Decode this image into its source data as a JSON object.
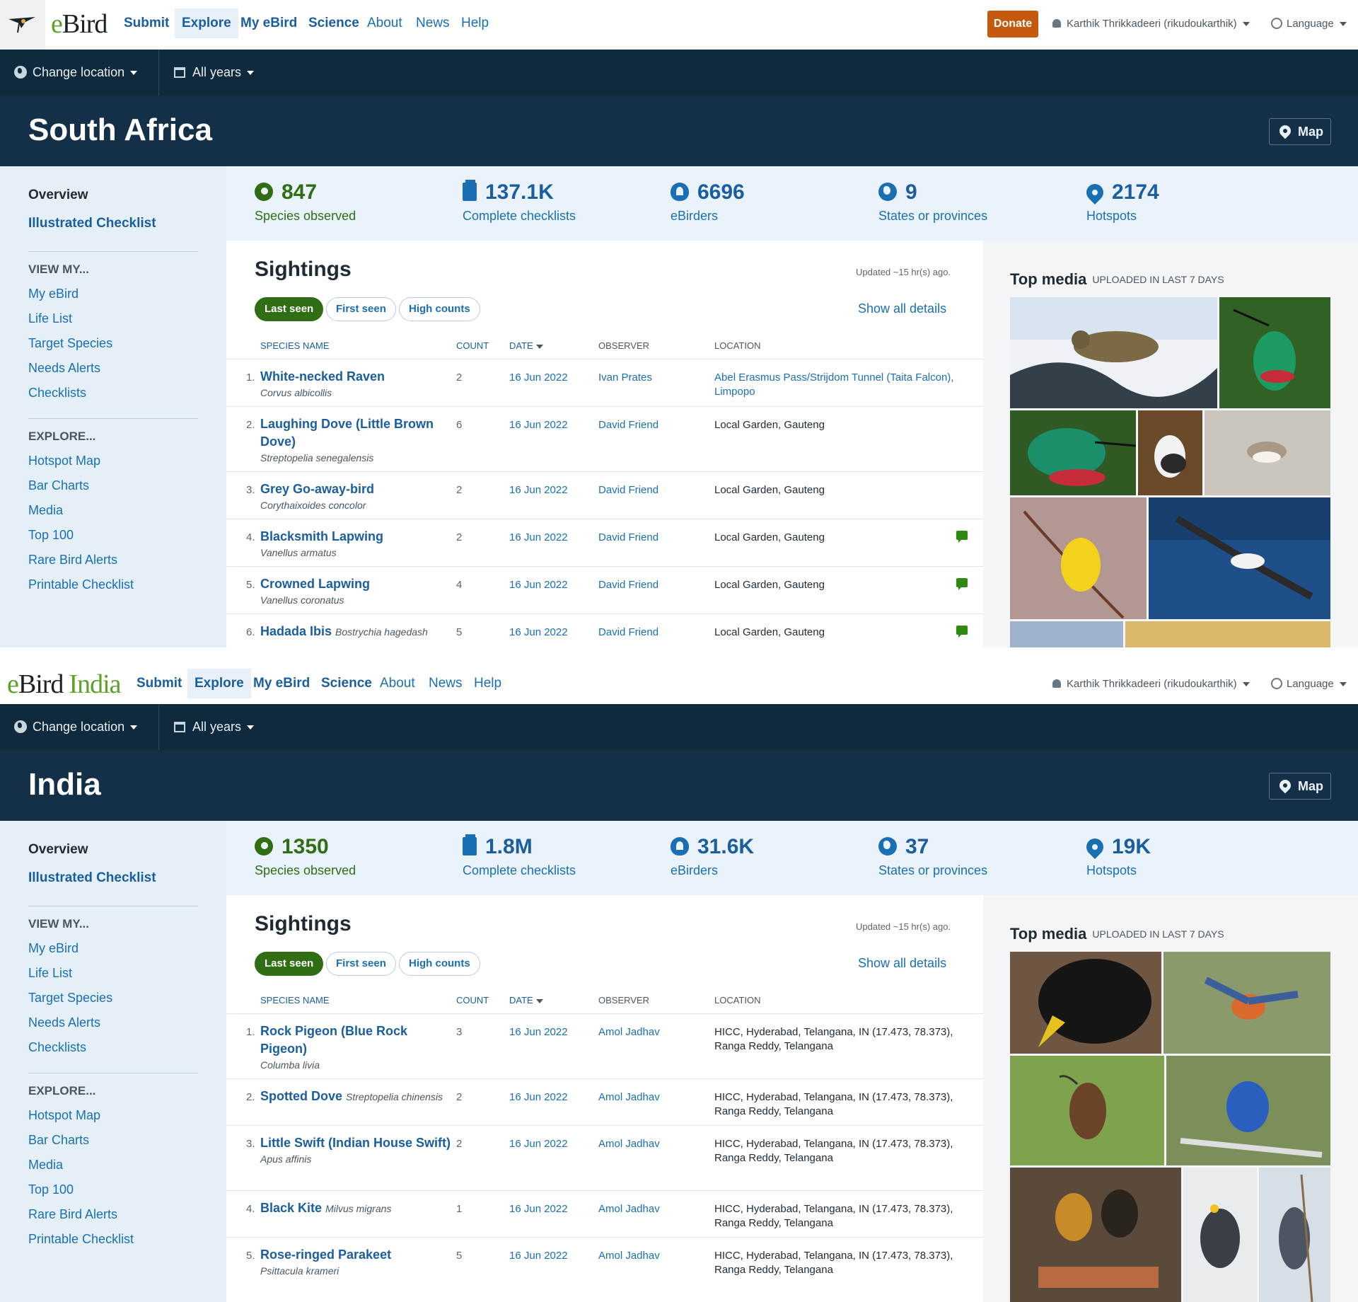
{
  "nav": {
    "submit": "Submit",
    "explore": "Explore",
    "my_ebird": "My eBird",
    "science": "Science",
    "about": "About",
    "news": "News",
    "help": "Help",
    "donate": "Donate",
    "user": "Karthik Thrikkadeeri (rikudoukarthik)",
    "language": "Language"
  },
  "logo": {
    "e": "e",
    "bird": "Bird",
    "india_region": "India"
  },
  "toolbar": {
    "change_location": "Change location",
    "all_years": "All years",
    "map": "Map"
  },
  "sidebar": {
    "overview": "Overview",
    "illustrated_checklist": "Illustrated Checklist",
    "view_my_heading": "VIEW MY...",
    "view_my": [
      "My eBird",
      "Life List",
      "Target Species",
      "Needs Alerts",
      "Checklists"
    ],
    "explore_heading": "EXPLORE...",
    "explore": [
      "Hotspot Map",
      "Bar Charts",
      "Media",
      "Top 100",
      "Rare Bird Alerts",
      "Printable Checklist"
    ]
  },
  "sightings_ui": {
    "title": "Sightings",
    "updated": "Updated ~15 hr(s) ago.",
    "tabs": [
      "Last seen",
      "First seen",
      "High counts"
    ],
    "show_all": "Show all details",
    "columns": [
      "SPECIES NAME",
      "COUNT",
      "DATE",
      "OBSERVER",
      "LOCATION"
    ]
  },
  "media_ui": {
    "title": "Top media",
    "subtitle": "UPLOADED IN LAST 7 DAYS"
  },
  "colors": {
    "brand_blue": "#1a5e9f",
    "brand_green": "#2f6e14",
    "header_dark": "#133048",
    "donate_orange": "#c55a0f"
  },
  "regions": [
    {
      "name": "South Africa",
      "stats": [
        {
          "value": "847",
          "label": "Species observed",
          "icon": "leaf-icon"
        },
        {
          "value": "137.1K",
          "label": "Complete checklists",
          "icon": "checklist-icon"
        },
        {
          "value": "6696",
          "label": "eBirders",
          "icon": "birder-icon"
        },
        {
          "value": "9",
          "label": "States or provinces",
          "icon": "globe-icon"
        },
        {
          "value": "2174",
          "label": "Hotspots",
          "icon": "hotspot-pin-icon"
        }
      ],
      "rows": [
        {
          "n": "1.",
          "species": "White-necked Raven",
          "sci": "Corvus albicollis",
          "count": "2",
          "date": "16 Jun 2022",
          "observer": "Ivan Prates",
          "location": "Abel Erasmus Pass/Strijdom Tunnel (Taita Falcon), Limpopo",
          "comment": false
        },
        {
          "n": "2.",
          "species": "Laughing Dove (Little Brown Dove)",
          "sci": "Streptopelia senegalensis",
          "count": "6",
          "date": "16 Jun 2022",
          "observer": "David Friend",
          "location": "Local Garden, Gauteng",
          "comment": false
        },
        {
          "n": "3.",
          "species": "Grey Go-away-bird",
          "sci": "Corythaixoides concolor",
          "count": "2",
          "date": "16 Jun 2022",
          "observer": "David Friend",
          "location": "Local Garden, Gauteng",
          "comment": false
        },
        {
          "n": "4.",
          "species": "Blacksmith Lapwing",
          "sci": "Vanellus armatus",
          "count": "2",
          "date": "16 Jun 2022",
          "observer": "David Friend",
          "location": "Local Garden, Gauteng",
          "comment": true
        },
        {
          "n": "5.",
          "species": "Crowned Lapwing",
          "sci": "Vanellus coronatus",
          "count": "4",
          "date": "16 Jun 2022",
          "observer": "David Friend",
          "location": "Local Garden, Gauteng",
          "comment": true
        },
        {
          "n": "6.",
          "species": "Hadada Ibis",
          "sci": "Bostrychia hagedash",
          "count": "5",
          "date": "16 Jun 2022",
          "observer": "David Friend",
          "location": "Local Garden, Gauteng",
          "comment": true
        }
      ]
    },
    {
      "name": "India",
      "stats": [
        {
          "value": "1350",
          "label": "Species observed",
          "icon": "leaf-icon"
        },
        {
          "value": "1.8M",
          "label": "Complete checklists",
          "icon": "checklist-icon"
        },
        {
          "value": "31.6K",
          "label": "eBirders",
          "icon": "birder-icon"
        },
        {
          "value": "37",
          "label": "States or provinces",
          "icon": "globe-icon"
        },
        {
          "value": "19K",
          "label": "Hotspots",
          "icon": "hotspot-pin-icon"
        }
      ],
      "rows": [
        {
          "n": "1.",
          "species": "Rock Pigeon (Blue Rock Pigeon)",
          "sci": "Columba livia",
          "count": "3",
          "date": "16 Jun 2022",
          "observer": "Amol Jadhav",
          "location": "HICC, Hyderabad, Telangana, IN (17.473, 78.373), Ranga Reddy, Telangana"
        },
        {
          "n": "2.",
          "species": "Spotted Dove",
          "sci": "Streptopelia chinensis",
          "count": "2",
          "date": "16 Jun 2022",
          "observer": "Amol Jadhav",
          "location": "HICC, Hyderabad, Telangana, IN (17.473, 78.373), Ranga Reddy, Telangana"
        },
        {
          "n": "3.",
          "species": "Little Swift (Indian House Swift)",
          "sci": "Apus affinis",
          "count": "2",
          "date": "16 Jun 2022",
          "observer": "Amol Jadhav",
          "location": "HICC, Hyderabad, Telangana, IN (17.473, 78.373), Ranga Reddy, Telangana"
        },
        {
          "n": "4.",
          "species": "Black Kite",
          "sci": "Milvus migrans",
          "count": "1",
          "date": "16 Jun 2022",
          "observer": "Amol Jadhav",
          "location": "HICC, Hyderabad, Telangana, IN (17.473, 78.373), Ranga Reddy, Telangana"
        },
        {
          "n": "5.",
          "species": "Rose-ringed Parakeet",
          "sci": "Psittacula krameri",
          "count": "5",
          "date": "16 Jun 2022",
          "observer": "Amol Jadhav",
          "location": "HICC, Hyderabad, Telangana, IN (17.473, 78.373), Ranga Reddy, Telangana"
        }
      ]
    }
  ]
}
